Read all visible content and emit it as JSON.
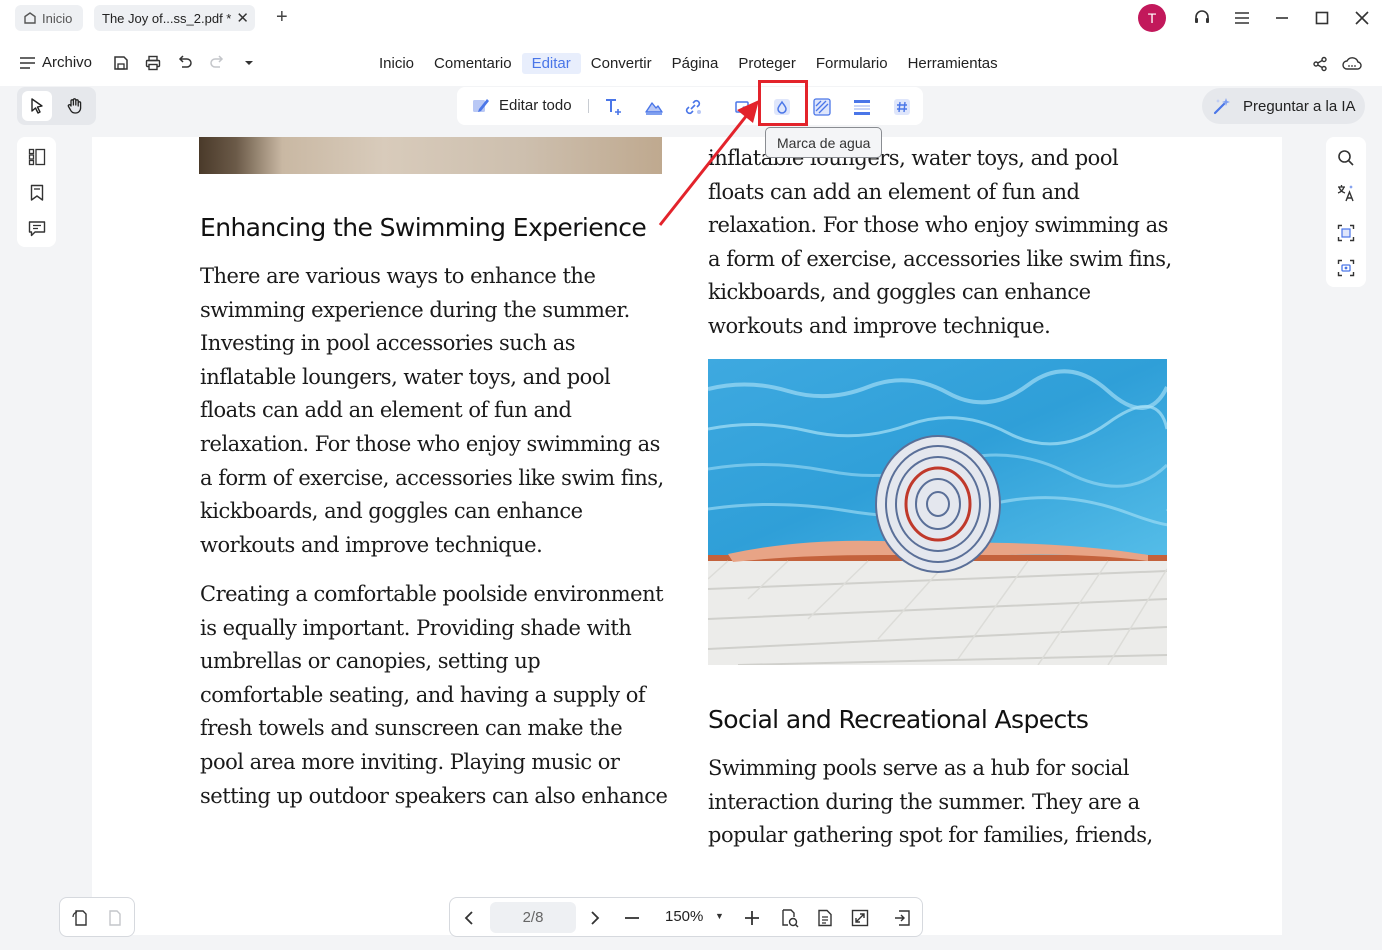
{
  "tabs": {
    "home_label": "Inicio",
    "doc_label": "The Joy of...ss_2.pdf *",
    "close_glyph": "✕",
    "add_glyph": "+"
  },
  "user": {
    "avatar_letter": "T",
    "avatar_color": "#c2185b"
  },
  "menu": {
    "file_label": "Archivo",
    "items": [
      "Inicio",
      "Comentario",
      "Editar",
      "Convertir",
      "Página",
      "Proteger",
      "Formulario",
      "Herramientas"
    ],
    "active_item": "Editar"
  },
  "edit_toolbar": {
    "edit_all_label": "Editar todo",
    "tooltip": "Marca de agua"
  },
  "ai": {
    "label": "Preguntar a la IA"
  },
  "document": {
    "left_heading": "Enhancing the Swimming Experience",
    "left_para1": [
      "There are various ways to enhance the",
      "swimming experience during the summer.",
      "Investing in pool accessories such as",
      "inflatable loungers, water toys, and pool",
      "floats can add an element of fun and",
      "relaxation. For those who enjoy swimming as",
      "a form of exercise, accessories like swim fins,",
      "kickboards, and goggles can enhance",
      "workouts and improve technique."
    ],
    "left_para2": [
      "Creating a comfortable poolside environment",
      "is equally important. Providing shade with",
      "umbrellas or canopies, setting up",
      "comfortable seating, and having a supply of",
      "fresh towels and sunscreen can make the",
      "pool area more inviting. Playing music or",
      "setting up outdoor speakers can also enhance"
    ],
    "right_para1": [
      "inflatable loungers, water toys, and pool",
      "floats can add an element of fun and",
      "relaxation. For those who enjoy swimming as",
      "a form of exercise, accessories like swim fins,",
      "kickboards, and goggles can enhance",
      "workouts and improve technique."
    ],
    "right_heading": "Social and Recreational Aspects",
    "right_para2": [
      "Swimming pools serve as a hub for social",
      "interaction during the summer. They are a",
      "popular gathering spot for families, friends,"
    ]
  },
  "navigation": {
    "page_indicator": "2/8",
    "zoom": "150%"
  },
  "colors": {
    "accent": "#4a76e8",
    "annotation_red": "#e3232b"
  }
}
